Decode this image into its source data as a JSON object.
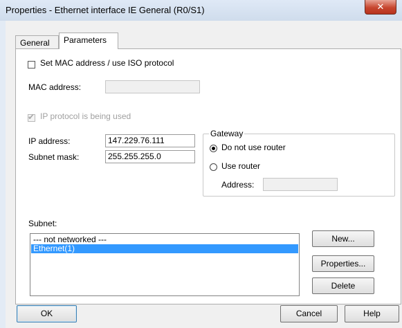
{
  "window": {
    "title": "Properties - Ethernet interface  IE General (R0/S1)",
    "close_glyph": "✕"
  },
  "tabs": [
    {
      "label": "General",
      "active": false
    },
    {
      "label": "Parameters",
      "active": true
    }
  ],
  "mac": {
    "checkbox_label": "Set MAC address / use ISO protocol",
    "checked": false,
    "address_label": "MAC address:",
    "address_value": ""
  },
  "ip": {
    "checkbox_label": "IP protocol is being used",
    "checked": true,
    "address_label": "IP address:",
    "address_value": "147.229.76.111",
    "subnet_label": "Subnet mask:",
    "subnet_value": "255.255.255.0"
  },
  "gateway": {
    "group_label": "Gateway",
    "option_no_router": "Do not use router",
    "option_use_router": "Use router",
    "selected": "Do not use router",
    "address_label": "Address:",
    "address_value": ""
  },
  "subnet": {
    "label": "Subnet:",
    "items": [
      "--- not networked ---",
      "Ethernet(1)"
    ],
    "selected_index": 1
  },
  "side_buttons": {
    "new": "New...",
    "properties": "Properties...",
    "delete": "Delete"
  },
  "footer": {
    "ok": "OK",
    "cancel": "Cancel",
    "help": "Help"
  },
  "colors": {
    "selection": "#3399ff",
    "close_button": "#c7462f"
  }
}
